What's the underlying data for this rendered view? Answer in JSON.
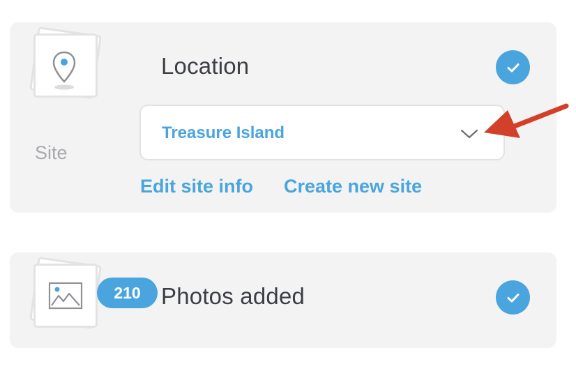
{
  "location_card": {
    "title": "Location",
    "status": "complete",
    "pin_icon": "map-pin-icon",
    "site_label": "Site",
    "select": {
      "value": "Treasure Island",
      "chevron_icon": "chevron-down-icon"
    },
    "links": {
      "edit": "Edit site info",
      "create": "Create new site"
    }
  },
  "photos_card": {
    "title": "Photos added",
    "status": "complete",
    "image_icon": "image-icon",
    "count": "210"
  },
  "annotation": {
    "arrow_icon": "red-arrow-icon",
    "arrow_color": "#d2402a"
  },
  "colors": {
    "accent": "#4aa5de",
    "card_bg": "#f3f3f3",
    "title_text": "#3b3e45",
    "muted_text": "#a7a9ad"
  }
}
